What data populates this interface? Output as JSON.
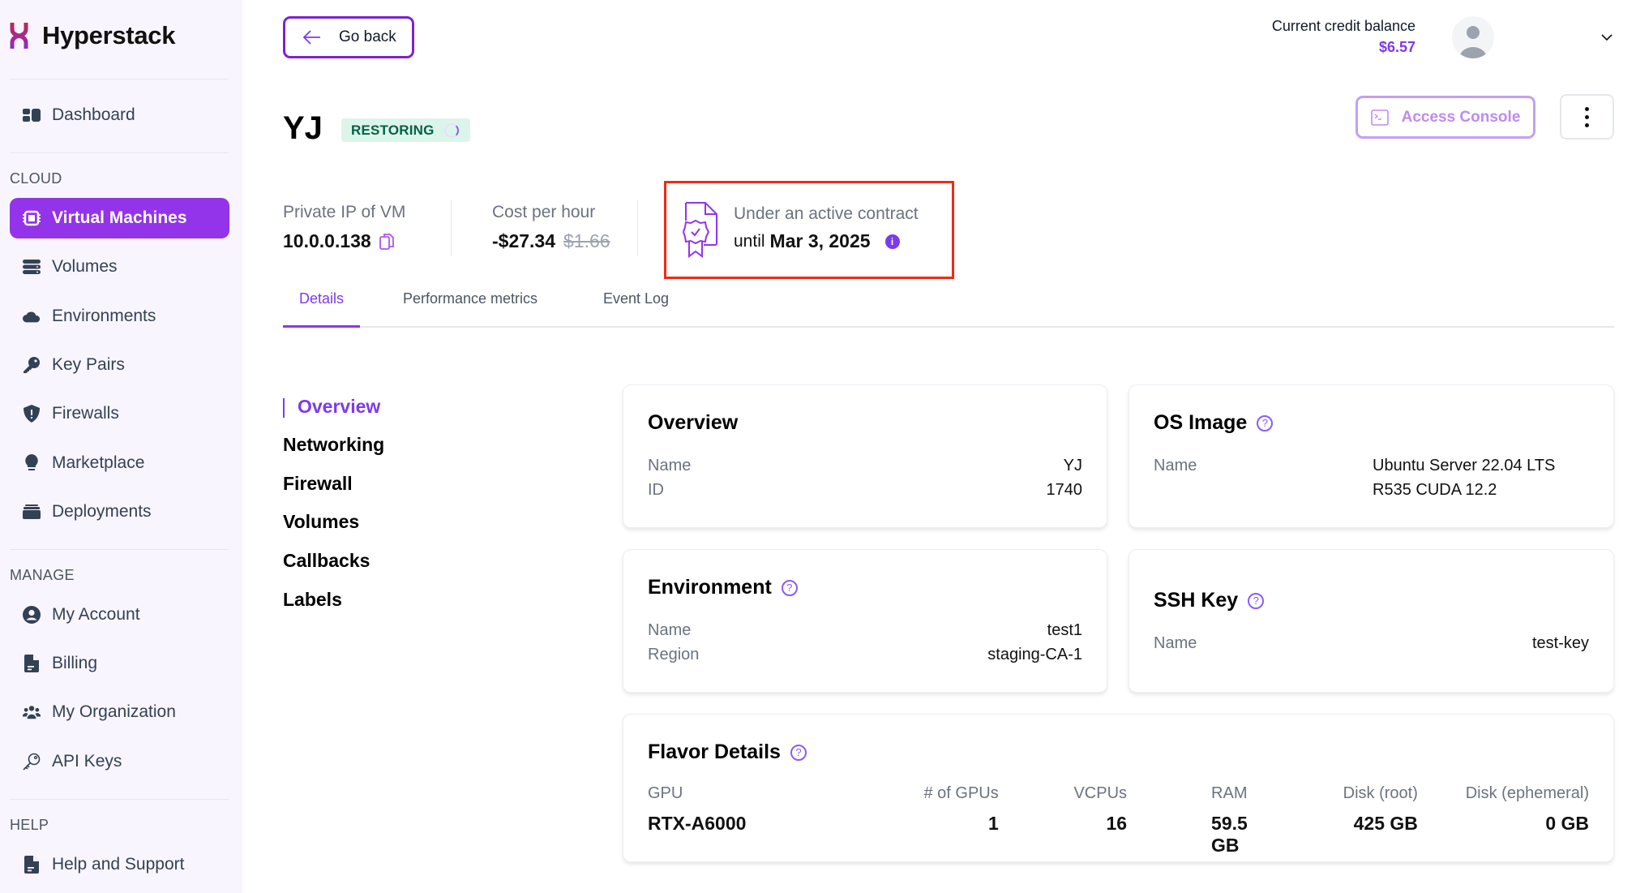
{
  "brand": {
    "name": "Hyperstack",
    "accent": "#9333ea"
  },
  "sidebar": {
    "top_items": [
      {
        "label": "Dashboard",
        "icon": "dashboard-icon"
      }
    ],
    "sections": [
      {
        "label": "CLOUD",
        "items": [
          {
            "label": "Virtual Machines",
            "icon": "chip-icon",
            "active": true
          },
          {
            "label": "Volumes",
            "icon": "database-icon"
          },
          {
            "label": "Environments",
            "icon": "cloud-icon"
          },
          {
            "label": "Key Pairs",
            "icon": "key-icon"
          },
          {
            "label": "Firewalls",
            "icon": "shield-icon"
          },
          {
            "label": "Marketplace",
            "icon": "lightbulb-icon"
          },
          {
            "label": "Deployments",
            "icon": "stack-icon"
          }
        ]
      },
      {
        "label": "MANAGE",
        "items": [
          {
            "label": "My Account",
            "icon": "user-circle-icon"
          },
          {
            "label": "Billing",
            "icon": "document-icon"
          },
          {
            "label": "My Organization",
            "icon": "users-icon"
          },
          {
            "label": "API Keys",
            "icon": "key-outline-icon"
          }
        ]
      },
      {
        "label": "HELP",
        "items": [
          {
            "label": "Help and Support",
            "icon": "document-icon"
          }
        ]
      }
    ]
  },
  "header": {
    "go_back_label": "Go back",
    "credit_label": "Current credit balance",
    "credit_value": "$6.57"
  },
  "vm": {
    "name": "YJ",
    "status": "RESTORING",
    "access_console_label": "Access Console",
    "private_ip_label": "Private IP of VM",
    "private_ip": "10.0.0.138",
    "cost_label": "Cost per hour",
    "cost_value": "-$27.34",
    "cost_original": "$1.66",
    "contract_label": "Under an active contract",
    "contract_until_prefix": "until",
    "contract_until_date": "Mar 3, 2025"
  },
  "tabs": [
    {
      "label": "Details",
      "active": true
    },
    {
      "label": "Performance metrics"
    },
    {
      "label": "Event Log"
    }
  ],
  "side_nav": [
    {
      "label": "Overview",
      "active": true
    },
    {
      "label": "Networking"
    },
    {
      "label": "Firewall"
    },
    {
      "label": "Volumes"
    },
    {
      "label": "Callbacks"
    },
    {
      "label": "Labels"
    }
  ],
  "cards": {
    "overview": {
      "title": "Overview",
      "rows": [
        {
          "k": "Name",
          "v": "YJ"
        },
        {
          "k": "ID",
          "v": "1740"
        }
      ]
    },
    "os_image": {
      "title": "OS Image",
      "rows": [
        {
          "k": "Name",
          "v1": "Ubuntu Server 22.04 LTS",
          "v2": "R535 CUDA 12.2"
        }
      ]
    },
    "environment": {
      "title": "Environment",
      "rows": [
        {
          "k": "Name",
          "v": "test1"
        },
        {
          "k": "Region",
          "v": "staging-CA-1"
        }
      ]
    },
    "ssh_key": {
      "title": "SSH Key",
      "rows": [
        {
          "k": "Name",
          "v": "test-key"
        }
      ]
    },
    "flavor": {
      "title": "Flavor Details",
      "columns": [
        {
          "k": "GPU",
          "v": "RTX-A6000"
        },
        {
          "k": "# of GPUs",
          "v": "1"
        },
        {
          "k": "VCPUs",
          "v": "16"
        },
        {
          "k": "RAM",
          "v": "59.5 GB"
        },
        {
          "k": "Disk (root)",
          "v": "425 GB"
        },
        {
          "k": "Disk (ephemeral)",
          "v": "0 GB"
        }
      ]
    }
  }
}
